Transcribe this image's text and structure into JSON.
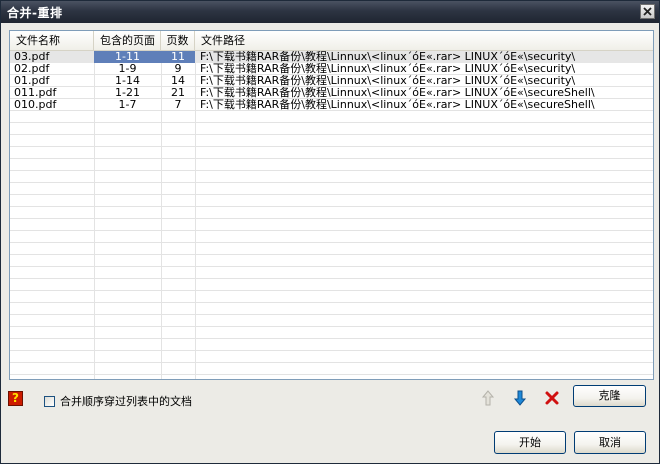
{
  "window": {
    "title": "合并-重排"
  },
  "list": {
    "columns": {
      "name": "文件名称",
      "pages": "包含的页面",
      "count": "页数",
      "path": "文件路径"
    },
    "rows": [
      {
        "name": "03.pdf",
        "pages": "1-11",
        "count": "11",
        "path": "F:\\下载书籍RAR备份\\教程\\Linnux\\<linux´óE«.rar> LINUX´óE«\\security\\"
      },
      {
        "name": "02.pdf",
        "pages": "1-9",
        "count": "9",
        "path": "F:\\下载书籍RAR备份\\教程\\Linnux\\<linux´óE«.rar> LINUX´óE«\\security\\"
      },
      {
        "name": "01.pdf",
        "pages": "1-14",
        "count": "14",
        "path": "F:\\下载书籍RAR备份\\教程\\Linnux\\<linux´óE«.rar> LINUX´óE«\\security\\"
      },
      {
        "name": "011.pdf",
        "pages": "1-21",
        "count": "21",
        "path": "F:\\下载书籍RAR备份\\教程\\Linnux\\<linux´óE«.rar> LINUX´óE«\\secureShell\\"
      },
      {
        "name": "010.pdf",
        "pages": "1-7",
        "count": "7",
        "path": "F:\\下载书籍RAR备份\\教程\\Linnux\\<linux´óE«.rar> LINUX´óE«\\secureShell\\"
      }
    ]
  },
  "options": {
    "help_glyph": "?",
    "checkbox_label": "合并顺序穿过列表中的文档",
    "checkbox_checked": false
  },
  "buttons": {
    "clone": "克隆",
    "start": "开始",
    "cancel": "取消"
  },
  "icons": {
    "move_up": "arrow-up-icon",
    "move_down": "arrow-down-icon",
    "delete": "delete-x-icon",
    "close": "close-icon",
    "help": "help-icon"
  },
  "colors": {
    "selection": "#5f7fb9",
    "title_bar": "#2d3442",
    "down_arrow": "#1e88d8",
    "delete_x": "#d01010",
    "help_bg": "#cc1b00",
    "help_fg": "#ffdf00"
  }
}
